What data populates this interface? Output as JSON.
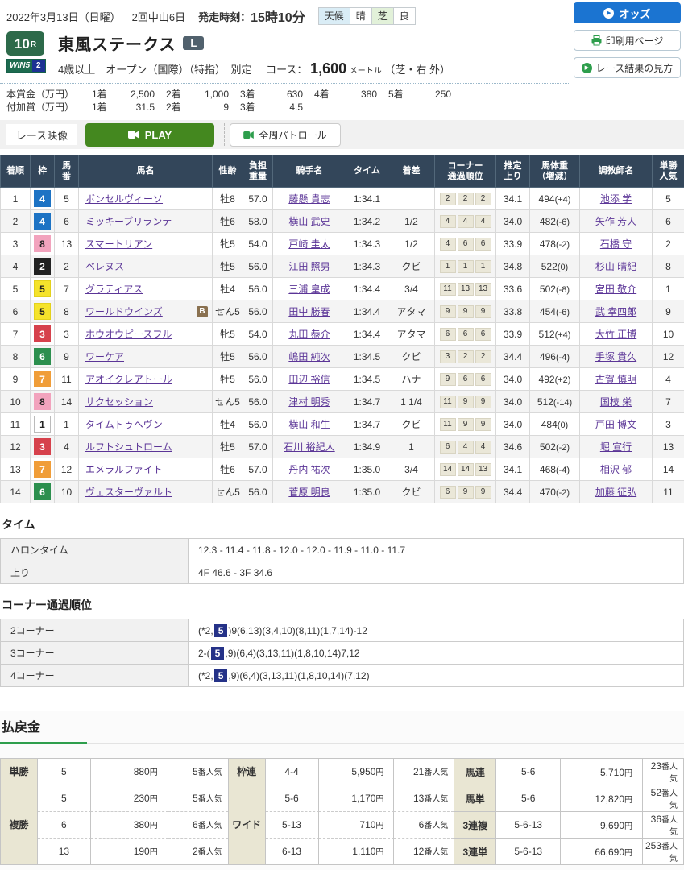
{
  "header": {
    "date": "2022年3月13日（日曜）",
    "meeting": "2回中山6日",
    "start_label": "発走時刻：",
    "start_time": "15時10分",
    "weather_label": "天候",
    "weather_value": "晴",
    "track_label": "芝",
    "track_value": "良",
    "odds_button": "オッズ",
    "print_button": "印刷用ページ",
    "guide_button": "レース結果の見方"
  },
  "race": {
    "number": "10",
    "number_suffix": "R",
    "win5_label": "WIN5",
    "win5_number": "2",
    "title": "東風ステークス",
    "grade": "L",
    "conditions": "4歳以上　オープン（国際）（特指）　別定",
    "course_label": "コース：",
    "course_distance": "1,600",
    "course_unit": "メートル",
    "course_detail": "（芝・右 外）",
    "prize_main": {
      "label": "本賞金（万円）",
      "items": [
        {
          "place": "1着",
          "value": "2,500"
        },
        {
          "place": "2着",
          "value": "1,000"
        },
        {
          "place": "3着",
          "value": "630"
        },
        {
          "place": "4着",
          "value": "380"
        },
        {
          "place": "5着",
          "value": "250"
        }
      ]
    },
    "prize_added": {
      "label": "付加賞（万円）",
      "items": [
        {
          "place": "1着",
          "value": "31.5"
        },
        {
          "place": "2着",
          "value": "9"
        },
        {
          "place": "3着",
          "value": "4.5"
        }
      ]
    }
  },
  "video": {
    "race_video_label": "レース映像",
    "play_label": "PLAY",
    "patrol_label": "全周パトロール"
  },
  "waku_colors": {
    "1": {
      "bg": "#ffffff",
      "fg": "#222222",
      "border": "#bbbbbb"
    },
    "2": {
      "bg": "#222222",
      "fg": "#ffffff",
      "border": "#222222"
    },
    "3": {
      "bg": "#d6414c",
      "fg": "#ffffff",
      "border": "#d6414c"
    },
    "4": {
      "bg": "#1d73c4",
      "fg": "#ffffff",
      "border": "#1d73c4"
    },
    "5": {
      "bg": "#f5e32b",
      "fg": "#222222",
      "border": "#e3d11c"
    },
    "6": {
      "bg": "#2c8f4e",
      "fg": "#ffffff",
      "border": "#2c8f4e"
    },
    "7": {
      "bg": "#f09d38",
      "fg": "#ffffff",
      "border": "#f09d38"
    },
    "8": {
      "bg": "#f2a3bd",
      "fg": "#222222",
      "border": "#f2a3bd"
    }
  },
  "results": {
    "blinker_label": "B",
    "headers": [
      "着順",
      "枠",
      "馬\n番",
      "馬名",
      "性齢",
      "負担\n重量",
      "騎手名",
      "タイム",
      "着差",
      "コーナー\n通過順位",
      "推定\n上り",
      "馬体重\n（増減）",
      "調教師名",
      "単勝\n人気"
    ],
    "rows": [
      {
        "pos": "1",
        "waku": "4",
        "num": "5",
        "name": "ボンセルヴィーソ",
        "blinker": false,
        "sex_age": "牡8",
        "weight": "57.0",
        "jockey": "藤懸 貴志",
        "time": "1:34.1",
        "margin": "",
        "corners": [
          "2",
          "2",
          "2"
        ],
        "last3f": "34.1",
        "body_weight": "494",
        "body_weight_diff": "(+4)",
        "trainer": "池添 学",
        "fav": "5"
      },
      {
        "pos": "2",
        "waku": "4",
        "num": "6",
        "name": "ミッキーブリランテ",
        "blinker": false,
        "sex_age": "牡6",
        "weight": "58.0",
        "jockey": "横山 武史",
        "time": "1:34.2",
        "margin": "1/2",
        "corners": [
          "4",
          "4",
          "4"
        ],
        "last3f": "34.0",
        "body_weight": "482",
        "body_weight_diff": "(-6)",
        "trainer": "矢作 芳人",
        "fav": "6"
      },
      {
        "pos": "3",
        "waku": "8",
        "num": "13",
        "name": "スマートリアン",
        "blinker": false,
        "sex_age": "牝5",
        "weight": "54.0",
        "jockey": "戸崎 圭太",
        "time": "1:34.3",
        "margin": "1/2",
        "corners": [
          "4",
          "6",
          "6"
        ],
        "last3f": "33.9",
        "body_weight": "478",
        "body_weight_diff": "(-2)",
        "trainer": "石橋 守",
        "fav": "2"
      },
      {
        "pos": "4",
        "waku": "2",
        "num": "2",
        "name": "ベレヌス",
        "blinker": false,
        "sex_age": "牡5",
        "weight": "56.0",
        "jockey": "江田 照男",
        "time": "1:34.3",
        "margin": "クビ",
        "corners": [
          "1",
          "1",
          "1"
        ],
        "last3f": "34.8",
        "body_weight": "522",
        "body_weight_diff": "(0)",
        "trainer": "杉山 晴紀",
        "fav": "8"
      },
      {
        "pos": "5",
        "waku": "5",
        "num": "7",
        "name": "グラティアス",
        "blinker": false,
        "sex_age": "牡4",
        "weight": "56.0",
        "jockey": "三浦 皇成",
        "time": "1:34.4",
        "margin": "3/4",
        "corners": [
          "11",
          "13",
          "13"
        ],
        "last3f": "33.6",
        "body_weight": "502",
        "body_weight_diff": "(-8)",
        "trainer": "宮田 敬介",
        "fav": "1"
      },
      {
        "pos": "6",
        "waku": "5",
        "num": "8",
        "name": "ワールドウインズ",
        "blinker": true,
        "sex_age": "せん5",
        "weight": "56.0",
        "jockey": "田中 勝春",
        "time": "1:34.4",
        "margin": "アタマ",
        "corners": [
          "9",
          "9",
          "9"
        ],
        "last3f": "33.8",
        "body_weight": "454",
        "body_weight_diff": "(-6)",
        "trainer": "武 幸四郎",
        "fav": "9"
      },
      {
        "pos": "7",
        "waku": "3",
        "num": "3",
        "name": "ホウオウピースフル",
        "blinker": false,
        "sex_age": "牝5",
        "weight": "54.0",
        "jockey": "丸田 恭介",
        "time": "1:34.4",
        "margin": "アタマ",
        "corners": [
          "6",
          "6",
          "6"
        ],
        "last3f": "33.9",
        "body_weight": "512",
        "body_weight_diff": "(+4)",
        "trainer": "大竹 正博",
        "fav": "10"
      },
      {
        "pos": "8",
        "waku": "6",
        "num": "9",
        "name": "ワーケア",
        "blinker": false,
        "sex_age": "牡5",
        "weight": "56.0",
        "jockey": "嶋田 純次",
        "time": "1:34.5",
        "margin": "クビ",
        "corners": [
          "3",
          "2",
          "2"
        ],
        "last3f": "34.4",
        "body_weight": "496",
        "body_weight_diff": "(-4)",
        "trainer": "手塚 貴久",
        "fav": "12"
      },
      {
        "pos": "9",
        "waku": "7",
        "num": "11",
        "name": "アオイクレアトール",
        "blinker": false,
        "sex_age": "牡5",
        "weight": "56.0",
        "jockey": "田辺 裕信",
        "time": "1:34.5",
        "margin": "ハナ",
        "corners": [
          "9",
          "6",
          "6"
        ],
        "last3f": "34.0",
        "body_weight": "492",
        "body_weight_diff": "(+2)",
        "trainer": "古賀 慎明",
        "fav": "4"
      },
      {
        "pos": "10",
        "waku": "8",
        "num": "14",
        "name": "サクセッション",
        "blinker": false,
        "sex_age": "せん5",
        "weight": "56.0",
        "jockey": "津村 明秀",
        "time": "1:34.7",
        "margin": "1 1/4",
        "corners": [
          "11",
          "9",
          "9"
        ],
        "last3f": "34.0",
        "body_weight": "512",
        "body_weight_diff": "(-14)",
        "trainer": "国枝 栄",
        "fav": "7"
      },
      {
        "pos": "11",
        "waku": "1",
        "num": "1",
        "name": "タイムトゥヘヴン",
        "blinker": false,
        "sex_age": "牡4",
        "weight": "56.0",
        "jockey": "横山 和生",
        "time": "1:34.7",
        "margin": "クビ",
        "corners": [
          "11",
          "9",
          "9"
        ],
        "last3f": "34.0",
        "body_weight": "484",
        "body_weight_diff": "(0)",
        "trainer": "戸田 博文",
        "fav": "3"
      },
      {
        "pos": "12",
        "waku": "3",
        "num": "4",
        "name": "ルフトシュトローム",
        "blinker": false,
        "sex_age": "牡5",
        "weight": "57.0",
        "jockey": "石川 裕紀人",
        "time": "1:34.9",
        "margin": "1",
        "corners": [
          "6",
          "4",
          "4"
        ],
        "last3f": "34.6",
        "body_weight": "502",
        "body_weight_diff": "(-2)",
        "trainer": "堀 宣行",
        "fav": "13"
      },
      {
        "pos": "13",
        "waku": "7",
        "num": "12",
        "name": "エメラルファイト",
        "blinker": false,
        "sex_age": "牡6",
        "weight": "57.0",
        "jockey": "丹内 祐次",
        "time": "1:35.0",
        "margin": "3/4",
        "corners": [
          "14",
          "14",
          "13"
        ],
        "last3f": "34.1",
        "body_weight": "468",
        "body_weight_diff": "(-4)",
        "trainer": "相沢 郁",
        "fav": "14"
      },
      {
        "pos": "14",
        "waku": "6",
        "num": "10",
        "name": "ヴェスターヴァルト",
        "blinker": false,
        "sex_age": "せん5",
        "weight": "56.0",
        "jockey": "菅原 明良",
        "time": "1:35.0",
        "margin": "クビ",
        "corners": [
          "6",
          "9",
          "9"
        ],
        "last3f": "34.4",
        "body_weight": "470",
        "body_weight_diff": "(-2)",
        "trainer": "加藤 征弘",
        "fav": "11"
      }
    ]
  },
  "time_section": {
    "heading": "タイム",
    "rows": [
      {
        "label": "ハロンタイム",
        "value": "12.3 - 11.4 - 11.8 - 12.0 - 12.0 - 11.9 - 11.0 - 11.7"
      },
      {
        "label": "上り",
        "value": "4F 46.6 - 3F 34.6"
      }
    ]
  },
  "corner_section": {
    "heading": "コーナー通過順位",
    "rows": [
      {
        "label": "2コーナー",
        "before": "(*2,",
        "highlight": "5",
        "after": ")9(6,13)(3,4,10)(8,11)(1,7,14)-12"
      },
      {
        "label": "3コーナー",
        "before": "2-(",
        "highlight": "5",
        "after": ",9)(6,4)(3,13,11)(1,8,10,14)7,12"
      },
      {
        "label": "4コーナー",
        "before": "(*2,",
        "highlight": "5",
        "after": ",9)(6,4)(3,13,11)(1,8,10,14)(7,12)"
      }
    ]
  },
  "payouts": {
    "heading": "払戻金",
    "yen": "円",
    "fav": "番人気",
    "left": [
      {
        "label": "単勝",
        "rows": [
          {
            "combo": "5",
            "amount": "880",
            "fav": "5"
          }
        ]
      },
      {
        "label": "複勝",
        "rows": [
          {
            "combo": "5",
            "amount": "230",
            "fav": "5"
          },
          {
            "combo": "6",
            "amount": "380",
            "fav": "6"
          },
          {
            "combo": "13",
            "amount": "190",
            "fav": "2"
          }
        ]
      }
    ],
    "middle": [
      {
        "label": "枠連",
        "rows": [
          {
            "combo": "4-4",
            "amount": "5,950",
            "fav": "21"
          }
        ]
      },
      {
        "label": "ワイド",
        "rows": [
          {
            "combo": "5-6",
            "amount": "1,170",
            "fav": "13"
          },
          {
            "combo": "5-13",
            "amount": "710",
            "fav": "6"
          },
          {
            "combo": "6-13",
            "amount": "1,110",
            "fav": "12"
          }
        ]
      }
    ],
    "right": [
      {
        "label": "馬連",
        "rows": [
          {
            "combo": "5-6",
            "amount": "5,710",
            "fav": "23"
          }
        ]
      },
      {
        "label": "馬単",
        "rows": [
          {
            "combo": "5-6",
            "amount": "12,820",
            "fav": "52"
          }
        ]
      },
      {
        "label": "3連複",
        "rows": [
          {
            "combo": "5-6-13",
            "amount": "9,690",
            "fav": "36"
          }
        ]
      },
      {
        "label": "3連単",
        "rows": [
          {
            "combo": "5-6-13",
            "amount": "66,690",
            "fav": "253"
          }
        ]
      }
    ]
  }
}
